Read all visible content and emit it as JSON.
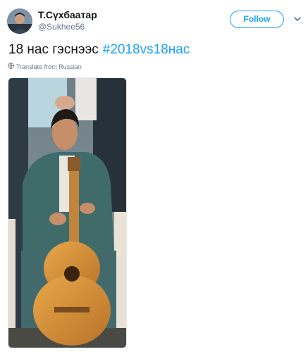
{
  "tweet": {
    "author": {
      "display_name": "Т.Сүхбаатар",
      "handle": "@Sukhee56"
    },
    "follow_label": "Follow",
    "text": "18 нас гэснээс",
    "hashtag": "#2018vs18нас",
    "translate_label": "Translate from Russian"
  },
  "icons": [
    "avatar",
    "chevron-down-icon",
    "globe-icon"
  ],
  "colors": {
    "accent": "#1da1f2",
    "text": "#14171a",
    "muted": "#657786"
  }
}
